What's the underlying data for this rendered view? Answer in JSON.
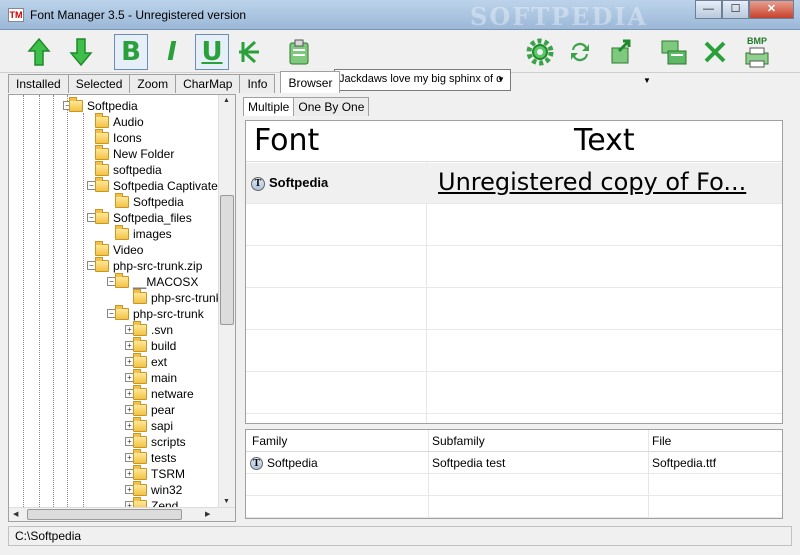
{
  "window": {
    "title": "Font Manager 3.5 - Unregistered version",
    "app_icon": "TM",
    "watermark": "SOFTPEDIA",
    "minimize": "—",
    "maximize": "☐",
    "close": "✕"
  },
  "toolbar": {
    "buttons": [
      {
        "name": "move-up-icon"
      },
      {
        "name": "move-down-icon"
      },
      {
        "name": "bold-button",
        "label": "B"
      },
      {
        "name": "italic-button",
        "label": "I"
      },
      {
        "name": "underline-button",
        "label": "U"
      },
      {
        "name": "strikeout-icon"
      },
      {
        "name": "clipboard-icon"
      },
      {
        "name": "settings-gear-icon"
      },
      {
        "name": "refresh-icon"
      },
      {
        "name": "export-icon"
      },
      {
        "name": "install-font-icon"
      },
      {
        "name": "delete-icon"
      },
      {
        "name": "bmp-print-icon",
        "label": "BMP"
      }
    ],
    "sample_text": "Jackdaws love my big sphinx of c"
  },
  "left_tabs": [
    "Installed",
    "Selected",
    "Zoom",
    "CharMap",
    "Info",
    "Browser"
  ],
  "active_left_tab": "Browser",
  "tree": [
    {
      "label": "Softpedia",
      "level": 0,
      "exp": "minus"
    },
    {
      "label": "Audio",
      "level": 1
    },
    {
      "label": "Icons",
      "level": 1
    },
    {
      "label": "New Folder",
      "level": 1
    },
    {
      "label": "softpedia",
      "level": 1
    },
    {
      "label": "Softpedia Captivate",
      "level": 1,
      "exp": "minus"
    },
    {
      "label": "Softpedia",
      "level": 2
    },
    {
      "label": "Softpedia_files",
      "level": 1,
      "exp": "minus"
    },
    {
      "label": "images",
      "level": 2
    },
    {
      "label": "Video",
      "level": 1
    },
    {
      "label": "php-src-trunk.zip",
      "level": 1,
      "exp": "minus"
    },
    {
      "label": "__MACOSX",
      "level": 2,
      "exp": "minus"
    },
    {
      "label": "php-src-trunk",
      "level": 3
    },
    {
      "label": "php-src-trunk",
      "level": 2,
      "exp": "minus"
    },
    {
      "label": ".svn",
      "level": 3,
      "exp": "plus"
    },
    {
      "label": "build",
      "level": 3,
      "exp": "plus"
    },
    {
      "label": "ext",
      "level": 3,
      "exp": "plus"
    },
    {
      "label": "main",
      "level": 3,
      "exp": "plus"
    },
    {
      "label": "netware",
      "level": 3,
      "exp": "plus"
    },
    {
      "label": "pear",
      "level": 3,
      "exp": "plus"
    },
    {
      "label": "sapi",
      "level": 3,
      "exp": "plus"
    },
    {
      "label": "scripts",
      "level": 3,
      "exp": "plus"
    },
    {
      "label": "tests",
      "level": 3,
      "exp": "plus"
    },
    {
      "label": "TSRM",
      "level": 3,
      "exp": "plus"
    },
    {
      "label": "win32",
      "level": 3,
      "exp": "plus"
    },
    {
      "label": "Zend",
      "level": 3,
      "exp": "plus"
    }
  ],
  "right_tabs": [
    "Multiple",
    "One By One"
  ],
  "active_right_tab": "Multiple",
  "preview": {
    "headers": {
      "font": "Font",
      "text": "Text"
    },
    "rows": [
      {
        "font": "Softpedia",
        "text": "Unregistered copy of Fo..."
      }
    ]
  },
  "details": {
    "headers": {
      "family": "Family",
      "subfamily": "Subfamily",
      "file": "File"
    },
    "rows": [
      {
        "family": "Softpedia",
        "subfamily": "Softpedia test",
        "file": "Softpedia.ttf"
      }
    ]
  },
  "status": {
    "path": "C:\\Softpedia"
  }
}
